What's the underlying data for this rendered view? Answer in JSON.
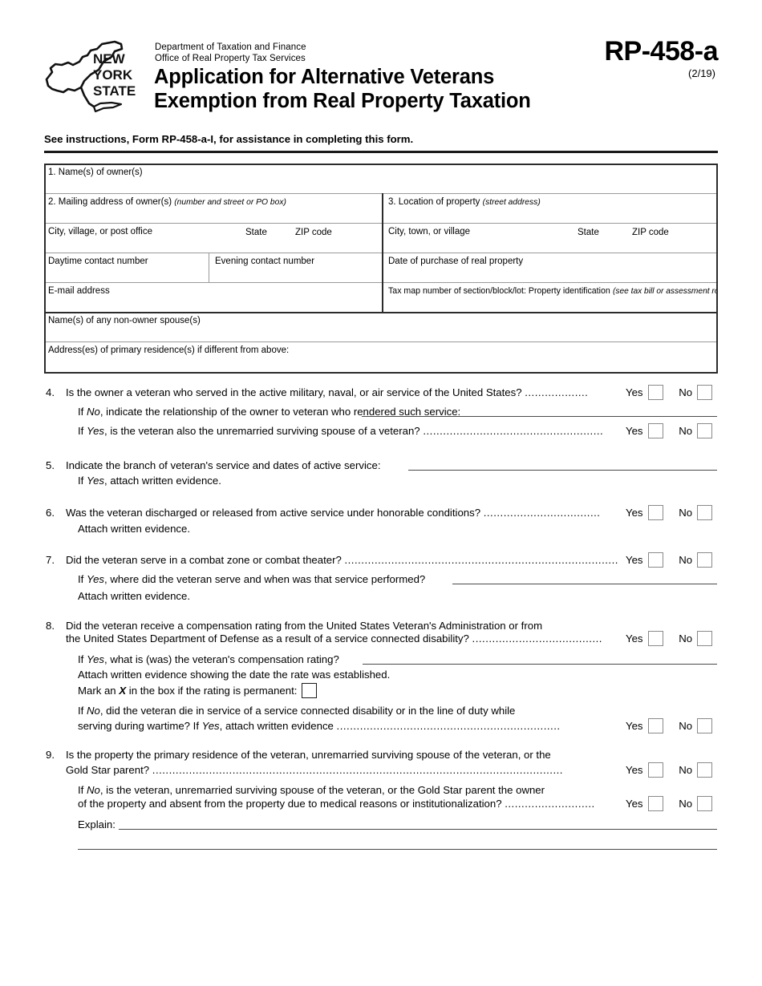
{
  "header": {
    "logo_alt": "new-york-state-outline-logo",
    "logo_text_lines": [
      "NEW",
      "YORK",
      "STATE"
    ],
    "agency_line1": "Department of Taxation and Finance",
    "agency_line2": "Office of Real Property Tax Services",
    "title_line1": "Application for Alternative Veterans",
    "title_line2": "Exemption from Real Property Taxation",
    "form_code": "RP-458-a",
    "revision": "(2/19)"
  },
  "instruction": "See instructions, Form RP-458-a-I, for assistance in completing this form.",
  "table": {
    "row1_label": "1.  Name(s) of owner(s)",
    "row2_left_label": "2.  Mailing address of owner(s)",
    "row2_left_italic": "(number and street or PO box)",
    "row2_right_label": "3.  Location of property",
    "row2_right_italic": "(street address)",
    "row3_left_label": "City, village, or post office",
    "row3_left_state": "State",
    "row3_left_zip": "ZIP code",
    "row3_right_label": "City, town, or village",
    "row3_right_state": "State",
    "row3_right_zip": "ZIP code",
    "row4_daytime": "Daytime contact number",
    "row4_evening": "Evening contact number",
    "row4_date_purchase": "Date of purchase of real property",
    "row5_email": "E-mail address",
    "row5_taxmap_label": "Tax map number of section/block/lot: Property identification",
    "row5_taxmap_italic": "(see tax bill or assessment roll)",
    "row6_spouse": "Name(s) of any non-owner spouse(s)",
    "row7_address": "Address(es) of primary residence(s) if different from above:"
  },
  "labels": {
    "yes": "Yes",
    "no": "No"
  },
  "questions": {
    "q4": {
      "num": "4.",
      "text": "Is the owner a veteran who served in the active military, naval, or air service of the United States?",
      "dots": "...................",
      "sub1_pre": "If ",
      "sub1_ital": "No",
      "sub1_post": ", indicate the relationship of the owner to veteran who rendered such service:",
      "sub2_pre": "If ",
      "sub2_ital": "Yes",
      "sub2_post": ", is the veteran also the unremarried surviving spouse of a veteran?",
      "sub2_dots": "......................................................"
    },
    "q5": {
      "num": "5.",
      "text": "Indicate the branch of veteran's service and dates of active service:",
      "sub1_pre": "If ",
      "sub1_ital": "Yes",
      "sub1_post": ", attach written evidence."
    },
    "q6": {
      "num": "6.",
      "text": "Was the veteran discharged or released from active service under honorable conditions?",
      "dots": "...................................",
      "sub1": "Attach written evidence."
    },
    "q7": {
      "num": "7.",
      "text": "Did the veteran serve in a combat zone or combat theater?",
      "dots": "..................................................................................",
      "sub1_pre": "If ",
      "sub1_ital": "Yes",
      "sub1_post": ", where did the veteran serve and when was that service performed?",
      "sub2": "Attach written evidence."
    },
    "q8": {
      "num": "8.",
      "line1": "Did the veteran receive a compensation rating from the United States Veteran's Administration or from",
      "line2": "the United States Department of Defense as a result of a service connected disability?",
      "line2_dots": ".......................................",
      "sub1_pre": "If ",
      "sub1_ital": "Yes",
      "sub1_post": ", what is (was) the veteran's compensation rating?",
      "sub2": "Attach written evidence showing the date the rate was established.",
      "sub3_pre": "Mark an ",
      "sub3_x": "X",
      "sub3_post": " in the box if the rating is permanent:",
      "sub4_pre": "If ",
      "sub4_ital": "No",
      "sub4_post": ", did the veteran die in service of a service connected disability or in the line of duty while",
      "sub5_pre": "serving during wartime? If ",
      "sub5_ital": "Yes",
      "sub5_post": ", attach written evidence",
      "sub5_dots": "..................................................................."
    },
    "q9": {
      "num": "9.",
      "line1": "Is the property the primary residence of the veteran, unremarried surviving spouse of the veteran, or the",
      "line2": "Gold Star parent?",
      "line2_dots": "...........................................................................................................................",
      "sub1_pre": "If ",
      "sub1_ital": "No",
      "sub1_post": ", is the veteran, unremarried surviving spouse of the veteran, or the Gold Star parent the owner",
      "sub2": "of the property and absent from the property due to medical reasons or institutionalization?",
      "sub2_dots": "...........................",
      "explain_label": "Explain:"
    }
  },
  "colors": {
    "text": "#000000",
    "rule_dark": "#1a1a1a",
    "table_border": "#9a9a9a",
    "checkbox_border": "#8a8a8a"
  }
}
